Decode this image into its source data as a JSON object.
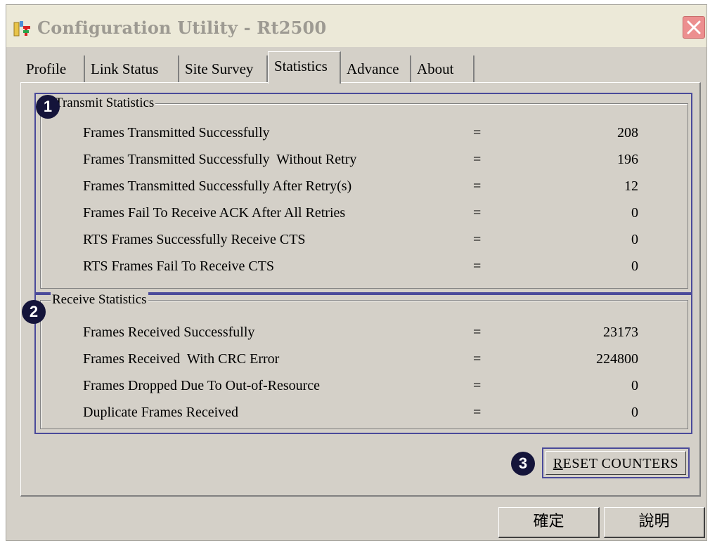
{
  "window": {
    "title": "Configuration Utility - Rt2500"
  },
  "tabs": [
    {
      "label": "Profile",
      "active": false
    },
    {
      "label": "Link Status",
      "active": false
    },
    {
      "label": "Site Survey",
      "active": false
    },
    {
      "label": "Statistics",
      "active": true
    },
    {
      "label": "Advance",
      "active": false
    },
    {
      "label": "About",
      "active": false
    }
  ],
  "transmit": {
    "badge": "1",
    "title": "Transmit Statistics",
    "rows": [
      {
        "label": "Frames Transmitted Successfully",
        "eq": "=",
        "value": "208"
      },
      {
        "label": "Frames Transmitted Successfully  Without Retry",
        "eq": "=",
        "value": "196"
      },
      {
        "label": "Frames Transmitted Successfully After Retry(s)",
        "eq": "=",
        "value": "12"
      },
      {
        "label": "Frames Fail To Receive ACK After All Retries",
        "eq": "=",
        "value": "0"
      },
      {
        "label": "RTS Frames Successfully Receive CTS",
        "eq": "=",
        "value": "0"
      },
      {
        "label": "RTS Frames Fail To Receive CTS",
        "eq": "=",
        "value": "0"
      }
    ]
  },
  "receive": {
    "badge": "2",
    "title": "Receive Statistics",
    "rows": [
      {
        "label": "Frames Received Successfully",
        "eq": "=",
        "value": "23173"
      },
      {
        "label": "Frames Received  With CRC Error",
        "eq": "=",
        "value": "224800"
      },
      {
        "label": "Frames Dropped Due To Out-of-Resource",
        "eq": "=",
        "value": "0"
      },
      {
        "label": "Duplicate Frames Received",
        "eq": "=",
        "value": "0"
      }
    ]
  },
  "reset": {
    "badge": "3",
    "mnemonic": "R",
    "label_rest": "ESET COUNTERS"
  },
  "footer": {
    "ok_label": "確定",
    "help_label": "說明"
  },
  "colors": {
    "face": "#d4d0c8",
    "highlight_border": "#4a4a9a",
    "badge": "#14143a"
  }
}
